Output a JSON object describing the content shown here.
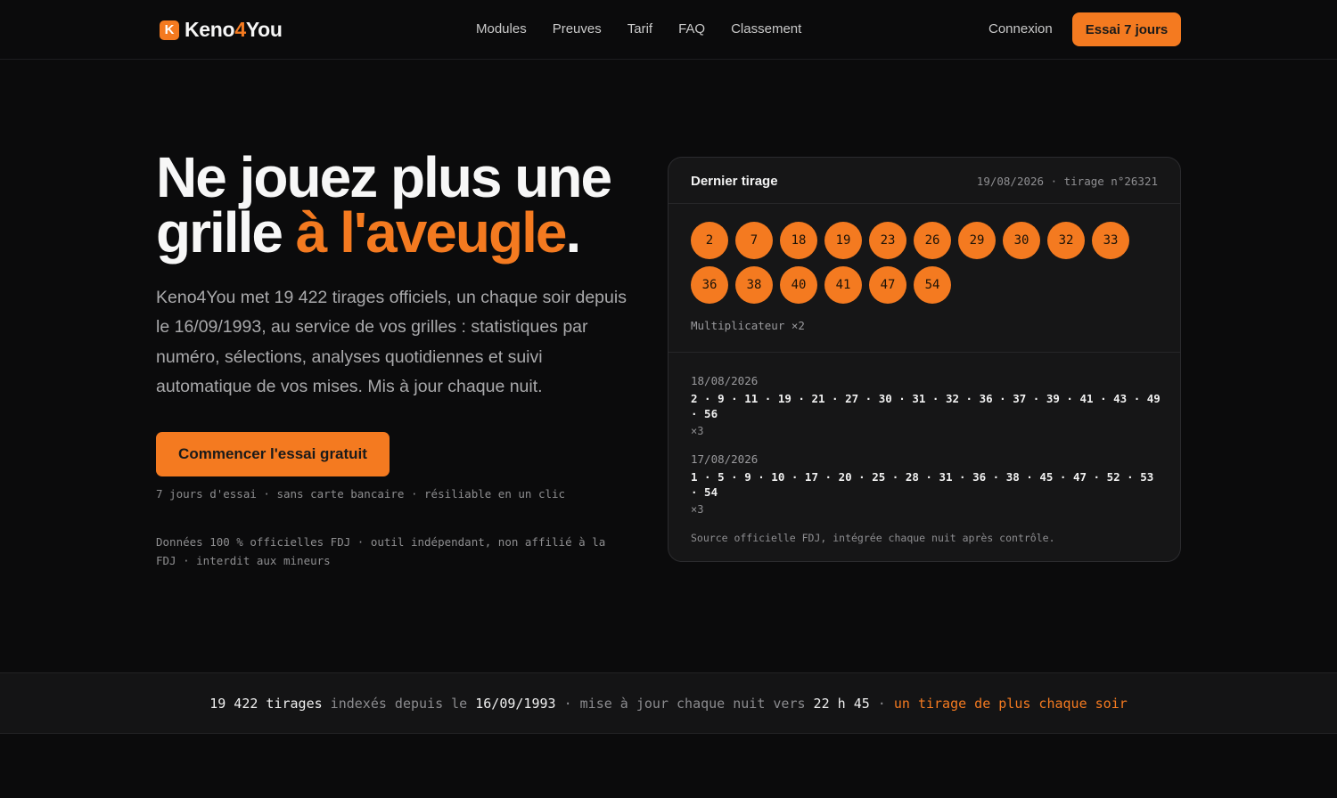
{
  "brand": {
    "name_part1": "Keno",
    "name_accent": "4",
    "name_part2": "You",
    "logo_letter": "K",
    "accent_color": "#f47a20"
  },
  "nav": {
    "items": [
      "Modules",
      "Preuves",
      "Tarif",
      "FAQ",
      "Classement"
    ],
    "login": "Connexion",
    "trial_button": "Essai 7 jours"
  },
  "hero": {
    "title_line1": "Ne jouez plus une",
    "title_line2_start": "grille ",
    "title_line2_accent": "à l'aveugle",
    "title_line2_end": ".",
    "subtitle": "Keno4You met 19 422 tirages officiels, un chaque soir depuis le 16/09/1993, au service de vos grilles : statistiques par numéro, sélections, analyses quotidiennes et suivi automatique de vos mises. Mis à jour chaque nuit.",
    "cta": "Commencer l'essai gratuit",
    "cta_note": "7 jours d'essai · sans carte bancaire · résiliable en un clic",
    "disclaimer": "Données 100 % officielles FDJ · outil indépendant, non affilié à la FDJ · interdit aux mineurs"
  },
  "card": {
    "title": "Dernier tirage",
    "meta": "19/08/2026 · tirage n°26321",
    "balls": [
      "2",
      "7",
      "18",
      "19",
      "23",
      "26",
      "29",
      "30",
      "32",
      "33",
      "36",
      "38",
      "40",
      "41",
      "47",
      "54"
    ],
    "multiplier": "Multiplicateur ×2",
    "history": [
      {
        "date": "18/08/2026",
        "numbers": "2 · 9 · 11 · 19 · 21 · 27 · 30 · 31 · 32 · 36 · 37 · 39 · 41 · 43 · 49 · 56",
        "mult": "×3"
      },
      {
        "date": "17/08/2026",
        "numbers": "1 · 5 · 9 · 10 · 17 · 20 · 25 · 28 · 31 · 36 · 38 · 45 · 47 · 52 · 53 · 54",
        "mult": "×3"
      }
    ],
    "source": "Source officielle FDJ, intégrée chaque nuit après contrôle."
  },
  "strip": {
    "count": "19 422 tirages",
    "t1": " indexés depuis le ",
    "date": "16/09/1993",
    "t2": " · mise à jour chaque nuit vers ",
    "time": "22 h 45",
    "t3": " · ",
    "accent": "un tirage de plus chaque soir"
  }
}
